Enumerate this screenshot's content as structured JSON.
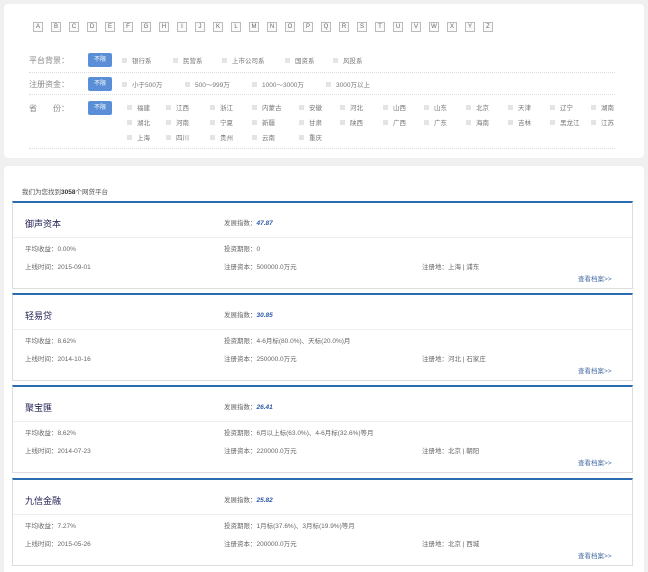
{
  "letters": [
    "A",
    "B",
    "C",
    "D",
    "E",
    "F",
    "G",
    "H",
    "I",
    "J",
    "K",
    "L",
    "M",
    "N",
    "O",
    "P",
    "Q",
    "R",
    "S",
    "T",
    "U",
    "V",
    "W",
    "X",
    "Y",
    "Z"
  ],
  "filters": {
    "background": {
      "label": "平台背景：",
      "all_label": "不限",
      "options": [
        "银行系",
        "民营系",
        "上市公司系",
        "国资系",
        "风投系"
      ]
    },
    "capital": {
      "label": "注册资金：",
      "all_label": "不限",
      "options": [
        "小于500万",
        "500～999万",
        "1000～3000万",
        "3000万以上"
      ]
    },
    "province": {
      "label": "省　　份：",
      "all_label": "不限",
      "options": [
        "福建",
        "江西",
        "浙江",
        "内蒙古",
        "安徽",
        "河北",
        "山西",
        "山东",
        "北京",
        "天津",
        "辽宁",
        "湖南",
        "湖北",
        "河南",
        "宁夏",
        "新疆",
        "甘肃",
        "陕西",
        "广西",
        "广东",
        "海南",
        "吉林",
        "黑龙江",
        "江苏",
        "上海",
        "四川",
        "贵州",
        "云南",
        "重庆"
      ]
    }
  },
  "result": {
    "prefix": "我们为您找到",
    "count": "3058",
    "suffix": "个网贷平台"
  },
  "labels": {
    "index": "发展指数：",
    "avg_return": "平均收益：",
    "period": "投资期限：",
    "online": "上线时间：",
    "capital": "注册资本：",
    "location": "注册地：",
    "view_link": "查看档案>>"
  },
  "platforms": [
    {
      "name": "御声资本",
      "index": "47.87",
      "avg_return": "0.00%",
      "period": "0",
      "online": "2015-09-01",
      "capital": "500000.0万元",
      "location": "上海 | 浦东"
    },
    {
      "name": "轻易贷",
      "index": "30.85",
      "avg_return": "8.62%",
      "period": "4-6月标(80.0%)、天标(20.0%)月",
      "online": "2014-10-16",
      "capital": "250000.0万元",
      "location": "河北 | 石家庄"
    },
    {
      "name": "聚宝匯",
      "index": "26.41",
      "avg_return": "8.62%",
      "period": "6月以上标(63.0%)、4-6月标(32.6%)等月",
      "online": "2014-07-23",
      "capital": "220000.0万元",
      "location": "北京 | 朝阳"
    },
    {
      "name": "九信金融",
      "index": "25.82",
      "avg_return": "7.27%",
      "period": "1月标(37.6%)、3月标(19.9%)等月",
      "online": "2015-05-26",
      "capital": "200000.0万元",
      "location": "北京 | 西城"
    }
  ]
}
